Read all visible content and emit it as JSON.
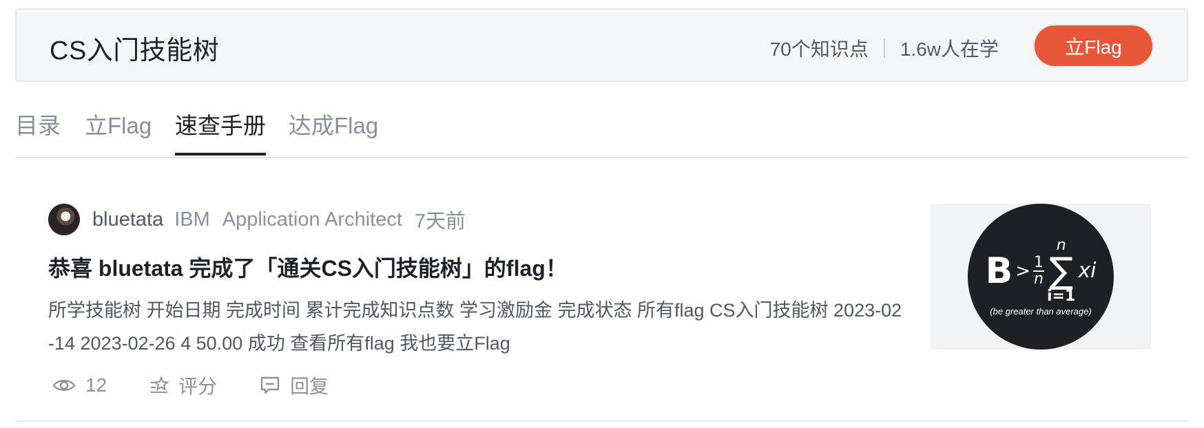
{
  "header": {
    "title": "CS入门技能树",
    "knowledge_points": "70个知识点",
    "learners": "1.6w人在学",
    "flag_button": "立Flag"
  },
  "tabs": [
    {
      "label": "目录"
    },
    {
      "label": "立Flag"
    },
    {
      "label": "速查手册",
      "active": true
    },
    {
      "label": "达成Flag"
    }
  ],
  "post": {
    "author": "bluetata",
    "company": "IBM",
    "job_title": "Application Architect",
    "time": "7天前",
    "title": "恭喜 bluetata 完成了「通关CS入门技能树」的flag！",
    "abstract": "所学技能树 开始日期 完成时间 累计完成知识点数 学习激励金 完成状态 所有flag CS入门技能树 2023-02-14 2023-02-26 4 50.00 成功 查看所有flag 我也要立Flag",
    "views": "12",
    "rate_label": "评分",
    "reply_label": "回复",
    "thumbnail": {
      "letter": "B",
      "gt": ">",
      "numerator": "1",
      "denominator": "n",
      "sigma_top": "n",
      "sigma": "∑",
      "sigma_bottom": "i=1",
      "term": "xi",
      "caption": "(be greater than average)"
    }
  },
  "colors": {
    "accent": "#e9573a",
    "text_primary": "#1d2129",
    "text_secondary": "#86909c",
    "header_bg": "#f4f5f7"
  }
}
